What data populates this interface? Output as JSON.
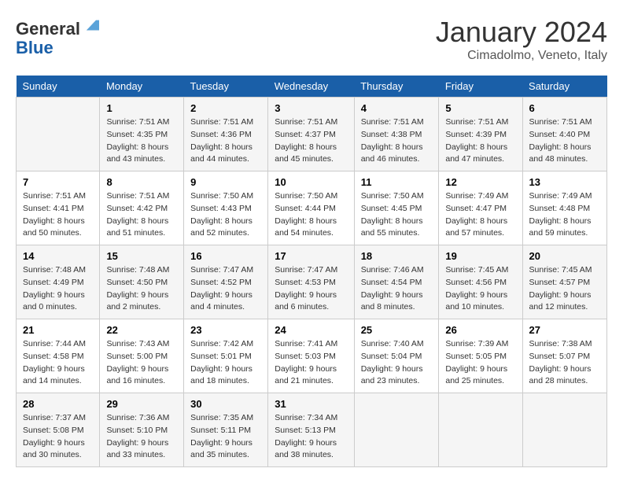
{
  "header": {
    "logo_line1": "General",
    "logo_line2": "Blue",
    "month": "January 2024",
    "location": "Cimadolmo, Veneto, Italy"
  },
  "days_of_week": [
    "Sunday",
    "Monday",
    "Tuesday",
    "Wednesday",
    "Thursday",
    "Friday",
    "Saturday"
  ],
  "weeks": [
    [
      {
        "day": "",
        "sunrise": "",
        "sunset": "",
        "daylight": ""
      },
      {
        "day": "1",
        "sunrise": "Sunrise: 7:51 AM",
        "sunset": "Sunset: 4:35 PM",
        "daylight": "Daylight: 8 hours and 43 minutes."
      },
      {
        "day": "2",
        "sunrise": "Sunrise: 7:51 AM",
        "sunset": "Sunset: 4:36 PM",
        "daylight": "Daylight: 8 hours and 44 minutes."
      },
      {
        "day": "3",
        "sunrise": "Sunrise: 7:51 AM",
        "sunset": "Sunset: 4:37 PM",
        "daylight": "Daylight: 8 hours and 45 minutes."
      },
      {
        "day": "4",
        "sunrise": "Sunrise: 7:51 AM",
        "sunset": "Sunset: 4:38 PM",
        "daylight": "Daylight: 8 hours and 46 minutes."
      },
      {
        "day": "5",
        "sunrise": "Sunrise: 7:51 AM",
        "sunset": "Sunset: 4:39 PM",
        "daylight": "Daylight: 8 hours and 47 minutes."
      },
      {
        "day": "6",
        "sunrise": "Sunrise: 7:51 AM",
        "sunset": "Sunset: 4:40 PM",
        "daylight": "Daylight: 8 hours and 48 minutes."
      }
    ],
    [
      {
        "day": "7",
        "sunrise": "Sunrise: 7:51 AM",
        "sunset": "Sunset: 4:41 PM",
        "daylight": "Daylight: 8 hours and 50 minutes."
      },
      {
        "day": "8",
        "sunrise": "Sunrise: 7:51 AM",
        "sunset": "Sunset: 4:42 PM",
        "daylight": "Daylight: 8 hours and 51 minutes."
      },
      {
        "day": "9",
        "sunrise": "Sunrise: 7:50 AM",
        "sunset": "Sunset: 4:43 PM",
        "daylight": "Daylight: 8 hours and 52 minutes."
      },
      {
        "day": "10",
        "sunrise": "Sunrise: 7:50 AM",
        "sunset": "Sunset: 4:44 PM",
        "daylight": "Daylight: 8 hours and 54 minutes."
      },
      {
        "day": "11",
        "sunrise": "Sunrise: 7:50 AM",
        "sunset": "Sunset: 4:45 PM",
        "daylight": "Daylight: 8 hours and 55 minutes."
      },
      {
        "day": "12",
        "sunrise": "Sunrise: 7:49 AM",
        "sunset": "Sunset: 4:47 PM",
        "daylight": "Daylight: 8 hours and 57 minutes."
      },
      {
        "day": "13",
        "sunrise": "Sunrise: 7:49 AM",
        "sunset": "Sunset: 4:48 PM",
        "daylight": "Daylight: 8 hours and 59 minutes."
      }
    ],
    [
      {
        "day": "14",
        "sunrise": "Sunrise: 7:48 AM",
        "sunset": "Sunset: 4:49 PM",
        "daylight": "Daylight: 9 hours and 0 minutes."
      },
      {
        "day": "15",
        "sunrise": "Sunrise: 7:48 AM",
        "sunset": "Sunset: 4:50 PM",
        "daylight": "Daylight: 9 hours and 2 minutes."
      },
      {
        "day": "16",
        "sunrise": "Sunrise: 7:47 AM",
        "sunset": "Sunset: 4:52 PM",
        "daylight": "Daylight: 9 hours and 4 minutes."
      },
      {
        "day": "17",
        "sunrise": "Sunrise: 7:47 AM",
        "sunset": "Sunset: 4:53 PM",
        "daylight": "Daylight: 9 hours and 6 minutes."
      },
      {
        "day": "18",
        "sunrise": "Sunrise: 7:46 AM",
        "sunset": "Sunset: 4:54 PM",
        "daylight": "Daylight: 9 hours and 8 minutes."
      },
      {
        "day": "19",
        "sunrise": "Sunrise: 7:45 AM",
        "sunset": "Sunset: 4:56 PM",
        "daylight": "Daylight: 9 hours and 10 minutes."
      },
      {
        "day": "20",
        "sunrise": "Sunrise: 7:45 AM",
        "sunset": "Sunset: 4:57 PM",
        "daylight": "Daylight: 9 hours and 12 minutes."
      }
    ],
    [
      {
        "day": "21",
        "sunrise": "Sunrise: 7:44 AM",
        "sunset": "Sunset: 4:58 PM",
        "daylight": "Daylight: 9 hours and 14 minutes."
      },
      {
        "day": "22",
        "sunrise": "Sunrise: 7:43 AM",
        "sunset": "Sunset: 5:00 PM",
        "daylight": "Daylight: 9 hours and 16 minutes."
      },
      {
        "day": "23",
        "sunrise": "Sunrise: 7:42 AM",
        "sunset": "Sunset: 5:01 PM",
        "daylight": "Daylight: 9 hours and 18 minutes."
      },
      {
        "day": "24",
        "sunrise": "Sunrise: 7:41 AM",
        "sunset": "Sunset: 5:03 PM",
        "daylight": "Daylight: 9 hours and 21 minutes."
      },
      {
        "day": "25",
        "sunrise": "Sunrise: 7:40 AM",
        "sunset": "Sunset: 5:04 PM",
        "daylight": "Daylight: 9 hours and 23 minutes."
      },
      {
        "day": "26",
        "sunrise": "Sunrise: 7:39 AM",
        "sunset": "Sunset: 5:05 PM",
        "daylight": "Daylight: 9 hours and 25 minutes."
      },
      {
        "day": "27",
        "sunrise": "Sunrise: 7:38 AM",
        "sunset": "Sunset: 5:07 PM",
        "daylight": "Daylight: 9 hours and 28 minutes."
      }
    ],
    [
      {
        "day": "28",
        "sunrise": "Sunrise: 7:37 AM",
        "sunset": "Sunset: 5:08 PM",
        "daylight": "Daylight: 9 hours and 30 minutes."
      },
      {
        "day": "29",
        "sunrise": "Sunrise: 7:36 AM",
        "sunset": "Sunset: 5:10 PM",
        "daylight": "Daylight: 9 hours and 33 minutes."
      },
      {
        "day": "30",
        "sunrise": "Sunrise: 7:35 AM",
        "sunset": "Sunset: 5:11 PM",
        "daylight": "Daylight: 9 hours and 35 minutes."
      },
      {
        "day": "31",
        "sunrise": "Sunrise: 7:34 AM",
        "sunset": "Sunset: 5:13 PM",
        "daylight": "Daylight: 9 hours and 38 minutes."
      },
      {
        "day": "",
        "sunrise": "",
        "sunset": "",
        "daylight": ""
      },
      {
        "day": "",
        "sunrise": "",
        "sunset": "",
        "daylight": ""
      },
      {
        "day": "",
        "sunrise": "",
        "sunset": "",
        "daylight": ""
      }
    ]
  ]
}
